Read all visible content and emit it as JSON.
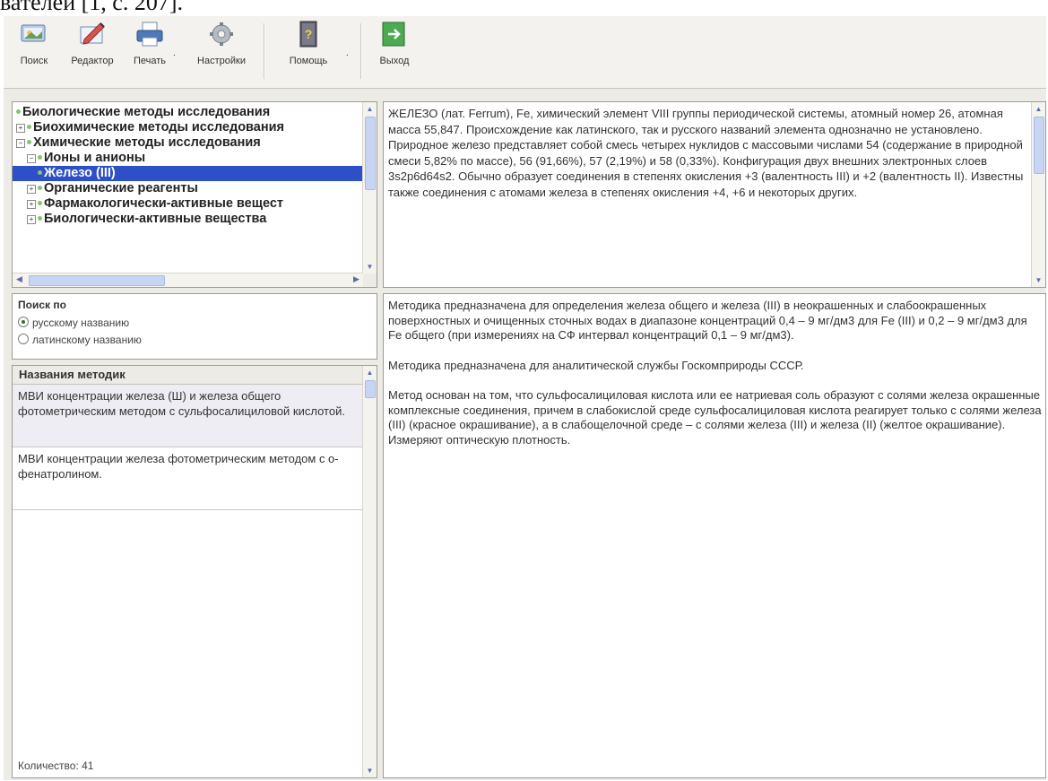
{
  "doc_caption": "вателей [1, с. 207].",
  "toolbar": {
    "buttons": [
      {
        "label": "Поиск",
        "icon": "search-icon"
      },
      {
        "label": "Редактор",
        "icon": "editor-icon"
      },
      {
        "label": "Печать",
        "icon": "printer-icon"
      },
      {
        "label": "Настройки",
        "icon": "gear-icon"
      },
      {
        "label": "Помощь",
        "icon": "help-book-icon"
      },
      {
        "label": "Выход",
        "icon": "exit-icon"
      }
    ],
    "dropdown_glyph": "."
  },
  "tree": {
    "items": [
      {
        "label": "Биологические методы исследования",
        "level": 0,
        "expander": ""
      },
      {
        "label": "Биохимические методы исследования",
        "level": 0,
        "expander": "+"
      },
      {
        "label": "Химические методы исследования",
        "level": 0,
        "expander": "−"
      },
      {
        "label": "Ионы и анионы",
        "level": 1,
        "expander": "−"
      },
      {
        "label": "Железо (III)",
        "level": 2,
        "expander": "",
        "selected": true
      },
      {
        "label": "Органические реагенты",
        "level": 1,
        "expander": "+"
      },
      {
        "label": "Фармакологически-активные вещест",
        "level": 1,
        "expander": "+"
      },
      {
        "label": "Биологически-активные вещества",
        "level": 1,
        "expander": "+"
      }
    ]
  },
  "description": {
    "text": "ЖЕЛЕЗО (лат. Ferrum), Fe, химический элемент VIII группы периодической системы, атомный номер 26, атомная масса 55,847. Происхождение как латинского, так и русского названий элемента однозначно не установлено. Природное железо представляет собой смесь четырех нуклидов с массовыми числами 54 (содержание в природной смеси 5,82% по массе), 56 (91,66%), 57 (2,19%) и 58 (0,33%). Конфигурация двух внешних электронных слоев 3s2p6d64s2. Обычно образует соединения в степенях окисления +3 (валентность III) и +2 (валентность II). Известны также соединения с атомами железа в степенях окисления +4, +6 и некоторых других."
  },
  "search": {
    "title": "Поиск по",
    "options": [
      {
        "label": "русскому названию",
        "selected": true
      },
      {
        "label": "латинскому названию",
        "selected": false
      }
    ]
  },
  "methods": {
    "header": "Названия методик",
    "items": [
      {
        "label": "МВИ концентрации железа (Ш) и железа общего фотометрическим методом с сульфосалициловой кислотой.",
        "selected": true
      },
      {
        "label": "МВИ концентрации железа фотометрическим методом с о-фенатролином.",
        "selected": false
      }
    ],
    "count": "Количество: 41"
  },
  "detail": {
    "paragraphs": [
      "Методика предназначена для определения железа общего и железа (III) в неокрашенных и слабоокрашенных поверхностных и очищенных сточных водах в диапазоне концентраций 0,4 – 9 мг/дм3 для Fe (III) и 0,2 – 9 мг/дм3 для Fe общего (при измерениях на СФ интервал концентраций 0,1 – 9 мг/дм3).",
      "Методика предназначена для аналитической службы Госкомприроды СССР.",
      "Метод основан на том, что сульфосалициловая кислота или ее натриевая соль образуют с солями железа окрашенные комплексные соединения, причем в слабокислой среде сульфосалициловая кислота реагирует только с солями железа (III) (красное окрашивание), а в слабощелочной среде – с солями железа (III) и железа (II) (желтое окрашивание). Измеряют оптическую плотность."
    ]
  },
  "colors": {
    "selection": "#2d4fc7",
    "tree_dot": "#86c36c",
    "window_bg": "#ecebe6"
  }
}
